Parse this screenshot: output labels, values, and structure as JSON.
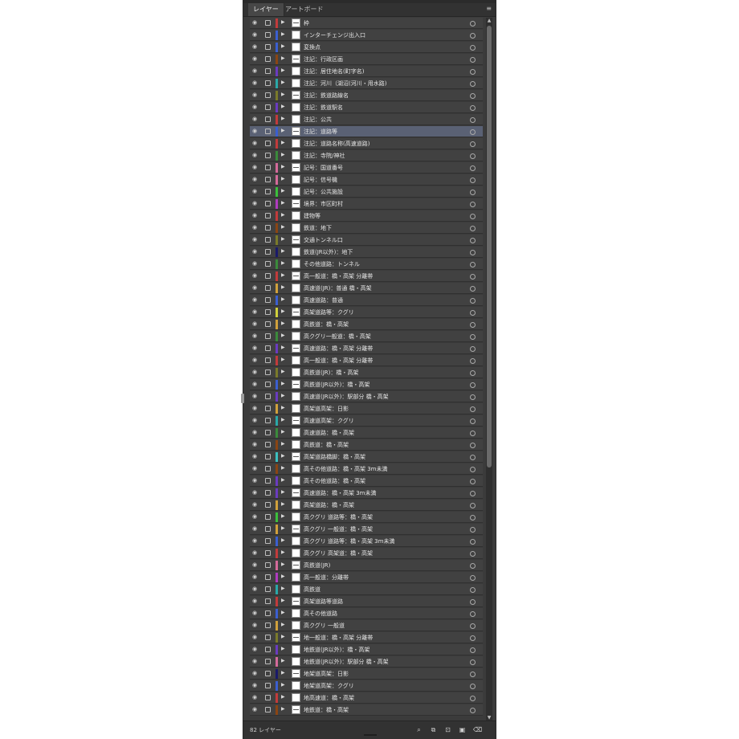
{
  "panel": {
    "tabs": [
      "レイヤー",
      "アートボード"
    ],
    "menu_icon": "≡",
    "layer_count": "82 レイヤー",
    "footer_icons": [
      "locate-object-icon",
      "make-clipping-mask-icon",
      "new-sublayer-icon",
      "new-layer-icon",
      "delete-icon"
    ],
    "glyphs": {
      "eye": "◉",
      "chevron": "▶",
      "up": "▲",
      "down": "▼",
      "f0": "⌕",
      "f1": "⧉",
      "f2": "⊡",
      "f3": "▣",
      "f4": "⌫"
    }
  },
  "layers": [
    {
      "name": "枠",
      "color": "#c23b3b"
    },
    {
      "name": "インターチェンジ出入口",
      "color": "#3b5fd0"
    },
    {
      "name": "変換点",
      "color": "#3b5fd0"
    },
    {
      "name": "注記：行政区画",
      "color": "#8b4513"
    },
    {
      "name": "注記：居住地名(町字名)",
      "color": "#6a3bc0"
    },
    {
      "name": "注記：河川（湖沼(河川・用水路)",
      "color": "#2aa8a8"
    },
    {
      "name": "注記：鉄道路線名",
      "color": "#7a7a2a"
    },
    {
      "name": "注記：鉄道駅名",
      "color": "#6a3bc0"
    },
    {
      "name": "注記：公共",
      "color": "#c23b3b"
    },
    {
      "name": "注記：道路等",
      "color": "#3b5fd0"
    },
    {
      "name": "注記：道路名称(高速道路)",
      "color": "#c23b3b"
    },
    {
      "name": "注記：寺院/神社",
      "color": "#3b8a3b"
    },
    {
      "name": "記号：国道番号",
      "color": "#d46a9a"
    },
    {
      "name": "記号：信号機",
      "color": "#d46a9a"
    },
    {
      "name": "記号：公共施設",
      "color": "#3bc03b"
    },
    {
      "name": "境界：市区町村",
      "color": "#b03bc0"
    },
    {
      "name": "建物等",
      "color": "#c23b3b"
    },
    {
      "name": "鉄道：地下",
      "color": "#8b4513"
    },
    {
      "name": "交通トンネル口",
      "color": "#7a7a2a"
    },
    {
      "name": "鉄道(JR以外)：地下",
      "color": "#1a1a6a"
    },
    {
      "name": "その他道路：トンネル",
      "color": "#3b8a3b"
    },
    {
      "name": "高一般道：橋・高架 分離帯",
      "color": "#c23b3b"
    },
    {
      "name": "高速道(JR)：普通 橋・高架",
      "color": "#d0a03b"
    },
    {
      "name": "高速道路：普通",
      "color": "#3b5fd0"
    },
    {
      "name": "高架道路等：クグリ",
      "color": "#d0d03b"
    },
    {
      "name": "高鉄道：橋・高架",
      "color": "#d0a03b"
    },
    {
      "name": "高クグリ一般道：橋・高架",
      "color": "#3b8a3b"
    },
    {
      "name": "高速道路：橋・高架 分離帯",
      "color": "#6a3bc0"
    },
    {
      "name": "高一般道：橋・高架 分離帯",
      "color": "#c23b3b"
    },
    {
      "name": "高鉄道(JR)：橋・高架",
      "color": "#7a7a2a"
    },
    {
      "name": "高鉄道(JR以外)：橋・高架",
      "color": "#3b5fd0"
    },
    {
      "name": "高速道(JR以外)：駅部分 橋・高架",
      "color": "#6a3bc0"
    },
    {
      "name": "高架道高架：日影",
      "color": "#d0a03b"
    },
    {
      "name": "高速道高架：クグリ",
      "color": "#2aa8a8"
    },
    {
      "name": "高速道路：橋・高架",
      "color": "#3b8a3b"
    },
    {
      "name": "高鉄道：橋・高架",
      "color": "#8b4513"
    },
    {
      "name": "高架道路橋脚：橋・高架",
      "color": "#3bc0c0"
    },
    {
      "name": "高その他道路：橋・高架 3m未満",
      "color": "#8b4513"
    },
    {
      "name": "高その他道路：橋・高架",
      "color": "#6a3bc0"
    },
    {
      "name": "高速道路：橋・高架 3m未満",
      "color": "#6a3bc0"
    },
    {
      "name": "高架道路：橋・高架",
      "color": "#d0a03b"
    },
    {
      "name": "高クグリ 道路等：橋・高架",
      "color": "#3bc03b"
    },
    {
      "name": "高クグリ 一般道：橋・高架",
      "color": "#d0a03b"
    },
    {
      "name": "高クグリ 道路等：橋・高架 3m未満",
      "color": "#3b5fd0"
    },
    {
      "name": "高クグリ 高架道：橋・高架",
      "color": "#c23b3b"
    },
    {
      "name": "高鉄道(JR)",
      "color": "#d46a9a"
    },
    {
      "name": "高一般道：分離帯",
      "color": "#b03bc0"
    },
    {
      "name": "高鉄道",
      "color": "#2aa8a8"
    },
    {
      "name": "高架道路等道路",
      "color": "#c23b3b"
    },
    {
      "name": "高その他道路",
      "color": "#3b5fd0"
    },
    {
      "name": "高クグリ 一般道",
      "color": "#d0a03b"
    },
    {
      "name": "地一般道：橋・高架 分離帯",
      "color": "#7a7a2a"
    },
    {
      "name": "地鉄道(JR以外)：橋・高架",
      "color": "#6a3bc0"
    },
    {
      "name": "地鉄道(JR以外)：駅部分 橋・高架",
      "color": "#d46a9a"
    },
    {
      "name": "地架道高架：日影",
      "color": "#1a1a6a"
    },
    {
      "name": "地架道高架：クグリ",
      "color": "#3b5fd0"
    },
    {
      "name": "地高速道：橋・高架",
      "color": "#c23b3b"
    },
    {
      "name": "地鉄道：橋・高架",
      "color": "#8b4513"
    }
  ],
  "selected_index": 9
}
